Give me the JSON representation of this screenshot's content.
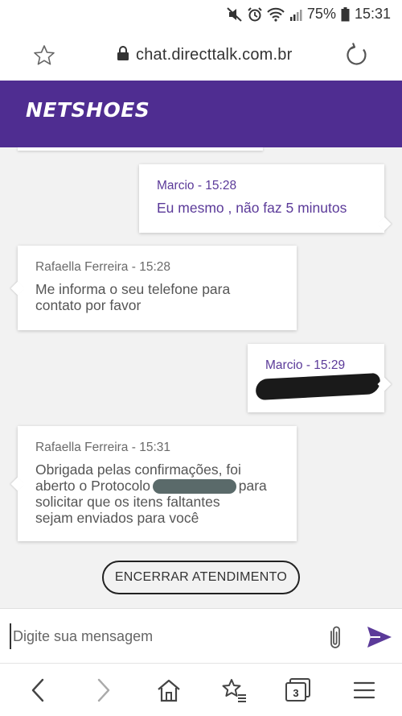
{
  "status_bar": {
    "battery": "75%",
    "time": "15:31",
    "icons": [
      "mute-icon",
      "alarm-icon",
      "wifi-icon",
      "signal-icon",
      "battery-icon"
    ]
  },
  "browser": {
    "url": "chat.directtalk.com.br",
    "tabs_count": "3"
  },
  "header": {
    "brand": "NETSHOES",
    "brand_color": "#4f2d91"
  },
  "messages": [
    {
      "author": "Marcio",
      "time": "15:28",
      "text": "Eu mesmo , não faz 5 minutos",
      "mine": true
    },
    {
      "author": "Rafaella Ferreira",
      "time": "15:28",
      "text_lines": [
        "Me informa o seu telefone para",
        "contato por favor"
      ],
      "mine": false
    },
    {
      "author": "Marcio",
      "time": "15:29",
      "text": "",
      "mine": true,
      "redacted": true
    },
    {
      "author": "Rafaella Ferreira",
      "time": "15:31",
      "text_lines": [
        "Obrigada pelas confirmações, foi",
        "aberto o Protocolo",
        "para",
        "solicitar que os itens faltantes",
        "sejam enviados para você"
      ],
      "mine": false
    }
  ],
  "end_button": "ENCERRAR ATENDIMENTO",
  "composer": {
    "placeholder": "Digite sua mensagem"
  },
  "colors": {
    "accent": "#5b3a99",
    "chat_bg": "#f2f2f2"
  }
}
